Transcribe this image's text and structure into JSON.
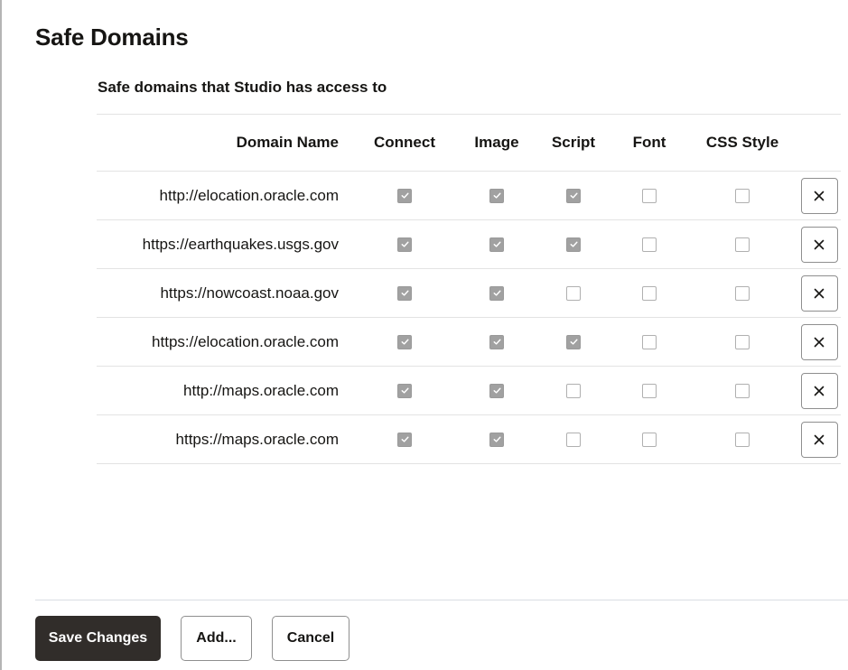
{
  "page": {
    "title": "Safe Domains",
    "subtitle": "Safe domains that Studio has access to"
  },
  "table": {
    "headers": {
      "domain": "Domain Name",
      "connect": "Connect",
      "image": "Image",
      "script": "Script",
      "font": "Font",
      "css": "CSS Style"
    },
    "rows": [
      {
        "domain": "http://elocation.oracle.com",
        "connect": true,
        "image": true,
        "script": true,
        "font": false,
        "css": false
      },
      {
        "domain": "https://earthquakes.usgs.gov",
        "connect": true,
        "image": true,
        "script": true,
        "font": false,
        "css": false
      },
      {
        "domain": "https://nowcoast.noaa.gov",
        "connect": true,
        "image": true,
        "script": false,
        "font": false,
        "css": false
      },
      {
        "domain": "https://elocation.oracle.com",
        "connect": true,
        "image": true,
        "script": true,
        "font": false,
        "css": false
      },
      {
        "domain": "http://maps.oracle.com",
        "connect": true,
        "image": true,
        "script": false,
        "font": false,
        "css": false
      },
      {
        "domain": "https://maps.oracle.com",
        "connect": true,
        "image": true,
        "script": false,
        "font": false,
        "css": false
      }
    ],
    "delete_icon": "close-icon"
  },
  "footer": {
    "save_label": "Save Changes",
    "add_label": "Add...",
    "cancel_label": "Cancel"
  },
  "colors": {
    "primary_button": "#312d2a",
    "checkbox_checked": "#a1a1a1"
  }
}
